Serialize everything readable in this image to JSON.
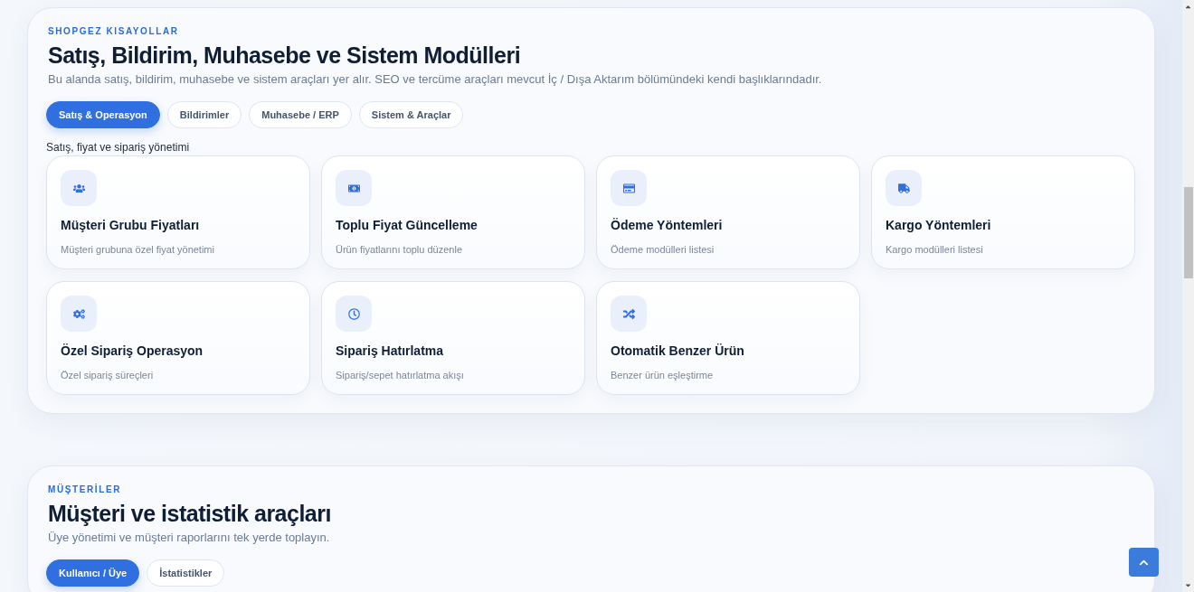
{
  "sections": [
    {
      "eyebrow": "SHOPGEZ KISAYOLLAR",
      "title": "Satış, Bildirim, Muhasebe ve Sistem Modülleri",
      "subtitle": "Bu alanda satış, bildirim, muhasebe ve sistem araçları yer alır. SEO ve tercüme araçları mevcut İç / Dışa Aktarım bölümündeki kendi başlıklarındadır.",
      "tabs": [
        {
          "label": "Satış & Operasyon",
          "selected": true
        },
        {
          "label": "Bildirimler",
          "selected": false
        },
        {
          "label": "Muhasebe / ERP",
          "selected": false
        },
        {
          "label": "Sistem & Araçlar",
          "selected": false
        }
      ],
      "group": {
        "label": "Satış, fiyat ve sipariş yönetimi",
        "cards": [
          {
            "title": "Müşteri Grubu Fiyatları",
            "description": "Müşteri grubuna özel fiyat yönetimi"
          },
          {
            "title": "Toplu Fiyat Güncelleme",
            "description": "Ürün fiyatlarını toplu düzenle"
          },
          {
            "title": "Ödeme Yöntemleri",
            "description": "Ödeme modülleri listesi"
          },
          {
            "title": "Kargo Yöntemleri",
            "description": "Kargo modülleri listesi"
          },
          {
            "title": "Özel Sipariş Operasyon",
            "description": "Özel sipariş süreçleri"
          },
          {
            "title": "Sipariş Hatırlatma",
            "description": "Sipariş/sepet hatırlatma akışı"
          },
          {
            "title": "Otomatik Benzer Ürün",
            "description": "Benzer ürün eşleştirme"
          }
        ]
      }
    },
    {
      "eyebrow": "MÜŞTERİLER",
      "title": "Müşteri ve istatistik araçları",
      "subtitle": "Üye yönetimi ve müşteri raporlarını tek yerde toplayın.",
      "tabs": [
        {
          "label": "Kullanıcı / Üye",
          "selected": true
        },
        {
          "label": "İstatistikler",
          "selected": false
        }
      ]
    }
  ]
}
